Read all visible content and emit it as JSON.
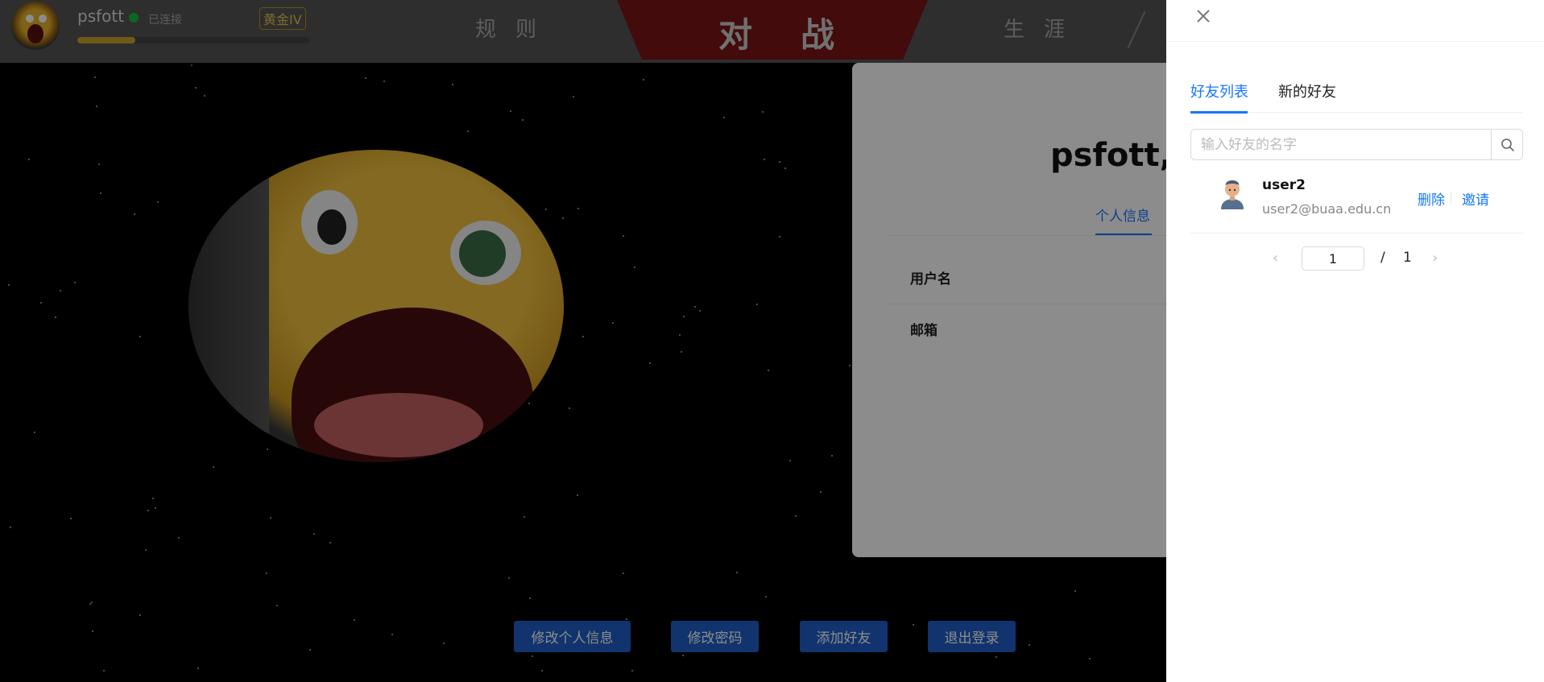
{
  "navbar": {
    "username": "psfott",
    "connection_status": "已连接",
    "rank": "黄金IV",
    "exp_fraction": 0.25,
    "links": {
      "rules": "规则",
      "battle": "对战",
      "career": "生涯"
    }
  },
  "profile": {
    "title": "psfott, 你",
    "tab_label": "个人信息",
    "fields": {
      "username_label": "用户名",
      "email_label": "邮箱"
    }
  },
  "actions": {
    "edit_info": "修改个人信息",
    "change_password": "修改密码",
    "add_friend": "添加好友",
    "logout": "退出登录"
  },
  "drawer": {
    "tabs": [
      "好友列表",
      "新的好友"
    ],
    "active_tab": 0,
    "search": {
      "placeholder": "输入好友的名字",
      "value": ""
    },
    "friends": [
      {
        "name": "user2",
        "email": "user2@buaa.edu.cn",
        "delete_label": "删除",
        "invite_label": "邀请"
      }
    ],
    "pagination": {
      "current": "1",
      "separator": "/",
      "total": "1"
    }
  },
  "colors": {
    "accent": "#1677ff",
    "button_blue": "#1f60c9",
    "battle_red": "#7a1515",
    "online_green": "#19be3a",
    "gold": "#c9a32a"
  },
  "icons": [
    "close-icon",
    "search-icon",
    "chevron-left-icon",
    "chevron-right-icon",
    "online-status-icon"
  ]
}
